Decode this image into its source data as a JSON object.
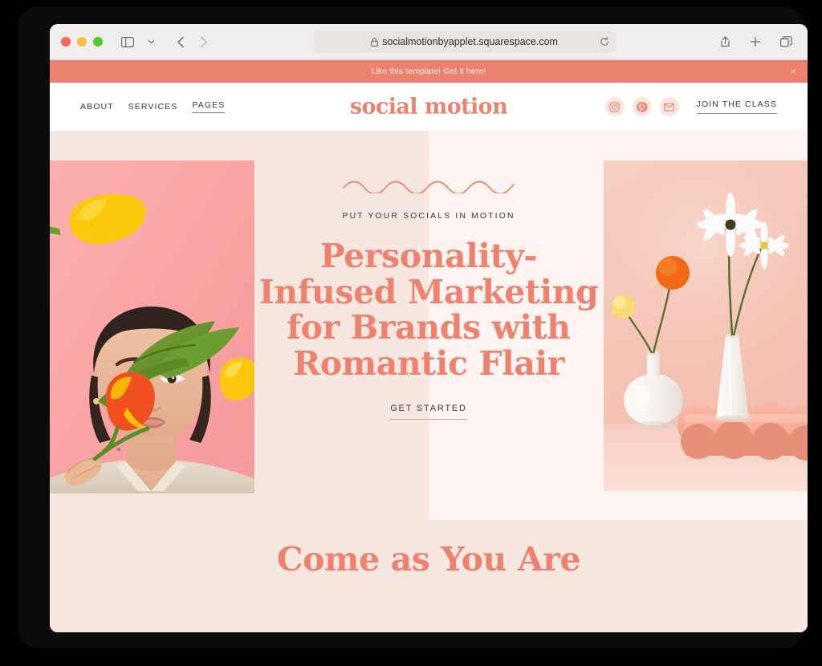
{
  "browser": {
    "url": "socialmotionbyapplet.squarespace.com",
    "lock_icon": "lock-icon",
    "reload_icon": "reload-icon",
    "traffic_lights": [
      "close",
      "minimize",
      "maximize"
    ],
    "sidebar_icon": "sidebar-toggle-icon",
    "chevron_icon": "chevron-down-icon",
    "back_icon": "back-arrow-icon",
    "forward_icon": "forward-arrow-icon",
    "share_icon": "share-icon",
    "newtab_icon": "plus-icon",
    "tabs_icon": "tab-overview-icon"
  },
  "promo": {
    "text": "Like this template! Get it here!",
    "close_label": "×"
  },
  "header": {
    "nav": [
      {
        "label": "ABOUT",
        "active": false
      },
      {
        "label": "SERVICES",
        "active": false
      },
      {
        "label": "PAGES",
        "active": true
      }
    ],
    "logo": "social motion",
    "social": [
      {
        "name": "instagram-icon"
      },
      {
        "name": "pinterest-icon"
      },
      {
        "name": "email-icon"
      }
    ],
    "cta": "JOIN THE CLASS"
  },
  "hero": {
    "eyebrow": "PUT YOUR SOCIALS IN MOTION",
    "headline_lines": [
      "Personality-",
      "Infused Marketing",
      "for Brands with",
      "Romantic Flair"
    ],
    "cta": "GET STARTED",
    "left_image_alt": "woman holding tulips on pink background",
    "right_image_alt": "white vases with daisies and craspedia on pink background"
  },
  "section": {
    "title": "Come as You Are"
  },
  "colors": {
    "coral": "#ec8270",
    "promo_bar": "#ec8170",
    "hero_bg": "#f6e7e1",
    "hero_panel": "#fdf3f0",
    "social_chip": "#fbe6e0",
    "text_dark": "#3a3a3c"
  }
}
